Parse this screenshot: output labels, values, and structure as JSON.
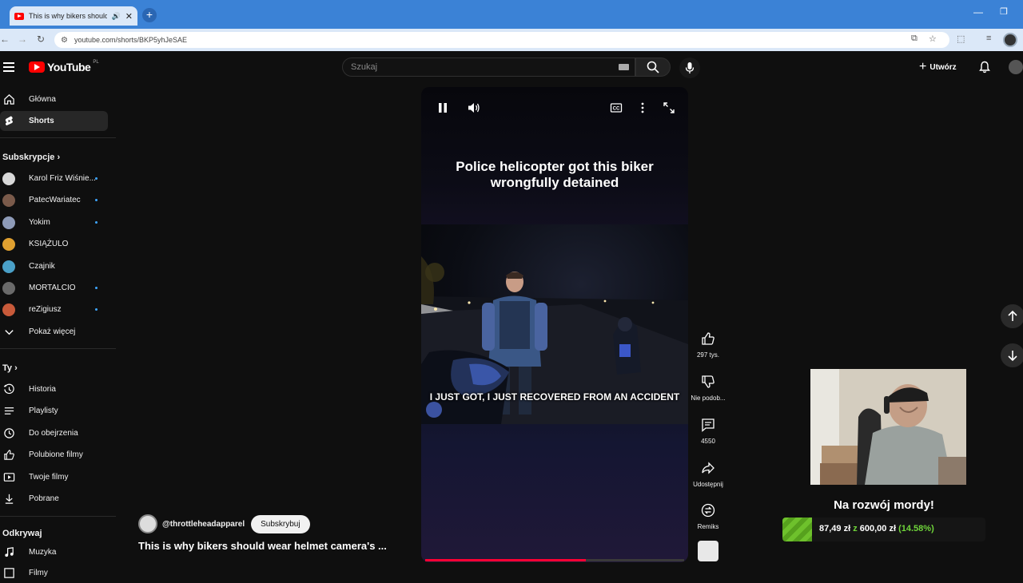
{
  "browser": {
    "tab_title": "This is why bikers should w...",
    "url": "youtube.com/shorts/BKP5yhJeSAE"
  },
  "header": {
    "logo_text": "YouTube",
    "country": "PL",
    "search_placeholder": "Szukaj",
    "create_label": "Utwórz"
  },
  "sidebar": {
    "main": [
      {
        "label": "Główna",
        "icon": "home-icon"
      },
      {
        "label": "Shorts",
        "icon": "shorts-icon",
        "active": true
      }
    ],
    "subscriptions_title": "Subskrypcje",
    "subscriptions": [
      {
        "label": "Karol Friz Wiśnie...",
        "new": true,
        "color": "#d8d8d8"
      },
      {
        "label": "PatecWariatec",
        "new": true,
        "color": "#7a5a4a"
      },
      {
        "label": "Yokim",
        "new": true,
        "color": "#8e9bb8"
      },
      {
        "label": "KSIĄŻULO",
        "new": false,
        "color": "#e0a030"
      },
      {
        "label": "Czajnik",
        "new": false,
        "color": "#4aa0c8"
      },
      {
        "label": "MORTALCIO",
        "new": true,
        "color": "#6a6a6a"
      },
      {
        "label": "reZigiusz",
        "new": true,
        "color": "#c85a3a"
      }
    ],
    "show_more": "Pokaż więcej",
    "you_title": "Ty",
    "you_items": [
      {
        "label": "Historia",
        "icon": "history-icon"
      },
      {
        "label": "Playlisty",
        "icon": "playlist-icon"
      },
      {
        "label": "Do obejrzenia",
        "icon": "clock-icon"
      },
      {
        "label": "Polubione filmy",
        "icon": "thumbs-up-icon"
      },
      {
        "label": "Twoje filmy",
        "icon": "video-icon"
      },
      {
        "label": "Pobrane",
        "icon": "download-icon"
      }
    ],
    "explore_title": "Odkrywaj",
    "explore_items": [
      {
        "label": "Muzyka",
        "icon": "music-icon"
      },
      {
        "label": "Filmy",
        "icon": "film-icon"
      }
    ]
  },
  "video": {
    "title_overlay": "Police helicopter got this biker wrongfully detained",
    "subtitle": "I JUST GOT, I JUST RECOVERED FROM AN ACCIDENT",
    "progress": 0.62
  },
  "actions": {
    "likes": "297 tys.",
    "dislike": "Nie podob...",
    "comments": "4550",
    "share": "Udostępnij",
    "remix": "Remiks"
  },
  "channel": {
    "name": "@throttleheadapparel",
    "subscribe": "Subskrybuj",
    "short_title": "This is why bikers should wear helmet camera's ..."
  },
  "stream_overlay": {
    "caption": "Na rozwój mordy!",
    "amount": "87,49 zł",
    "connector": "z",
    "goal": "600,00 zł",
    "percent": "(14.58%)",
    "progress": 0.1458
  }
}
